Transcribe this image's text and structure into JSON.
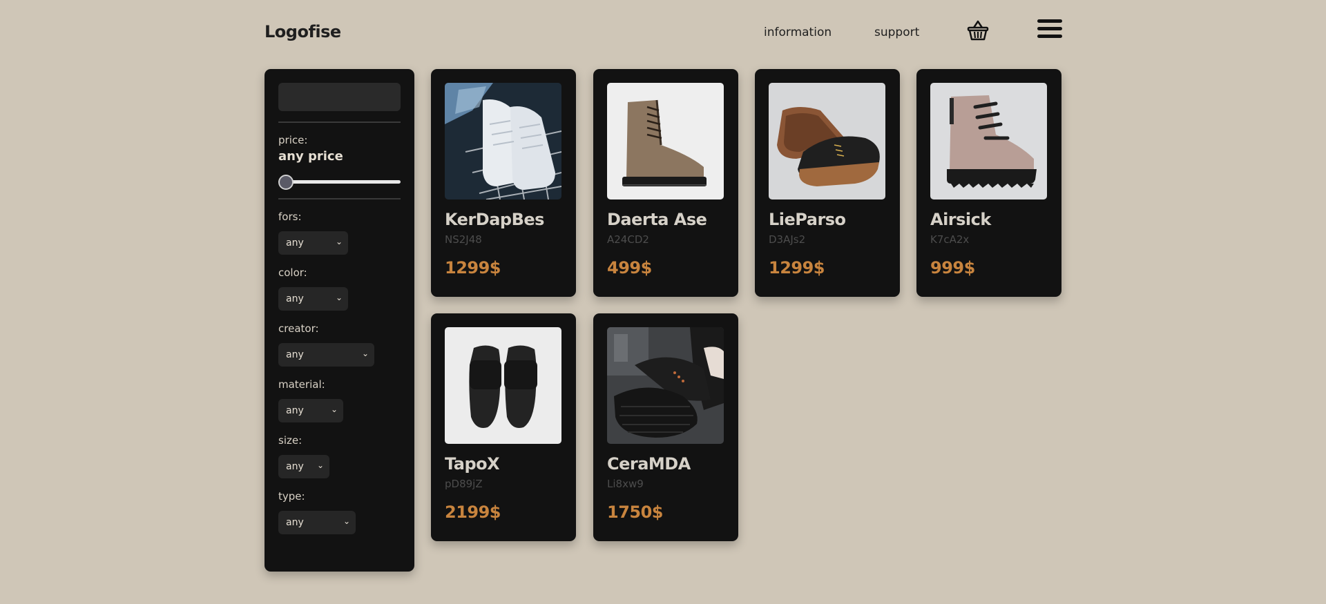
{
  "header": {
    "logo": "Logofise",
    "nav": [
      {
        "label": "information"
      },
      {
        "label": "support"
      }
    ]
  },
  "sidebar": {
    "search": {
      "value": "",
      "placeholder": ""
    },
    "price": {
      "label": "price:",
      "value": "any price",
      "slider_fraction": 0
    },
    "filters": [
      {
        "label": "fors:",
        "selected": "any"
      },
      {
        "label": "color:",
        "selected": "any"
      },
      {
        "label": "creator:",
        "selected": "any"
      },
      {
        "label": "material:",
        "selected": "any"
      },
      {
        "label": "size:",
        "selected": "any"
      },
      {
        "label": "type:",
        "selected": "any"
      }
    ]
  },
  "products": [
    {
      "name": "KerDapBes",
      "code": "NS2J48",
      "price": "1299$",
      "image": "white-sneakers"
    },
    {
      "name": "Daerta Ase",
      "code": "A24CD2",
      "price": "499$",
      "image": "tan-lace-up-boot"
    },
    {
      "name": "LieParso",
      "code": "D3AJs2",
      "price": "1299$",
      "image": "black-canvas-shoe"
    },
    {
      "name": "Airsick",
      "code": "K7cA2x",
      "price": "999$",
      "image": "pink-suede-boot"
    },
    {
      "name": "TapoX",
      "code": "pD89jZ",
      "price": "2199$",
      "image": "black-slides"
    },
    {
      "name": "CeraMDA",
      "code": "Li8xw9",
      "price": "1750$",
      "image": "black-knit-sneaker"
    }
  ],
  "colors": {
    "background": "#cfc6b7",
    "panel": "#121212",
    "price_accent": "#c8843e"
  }
}
